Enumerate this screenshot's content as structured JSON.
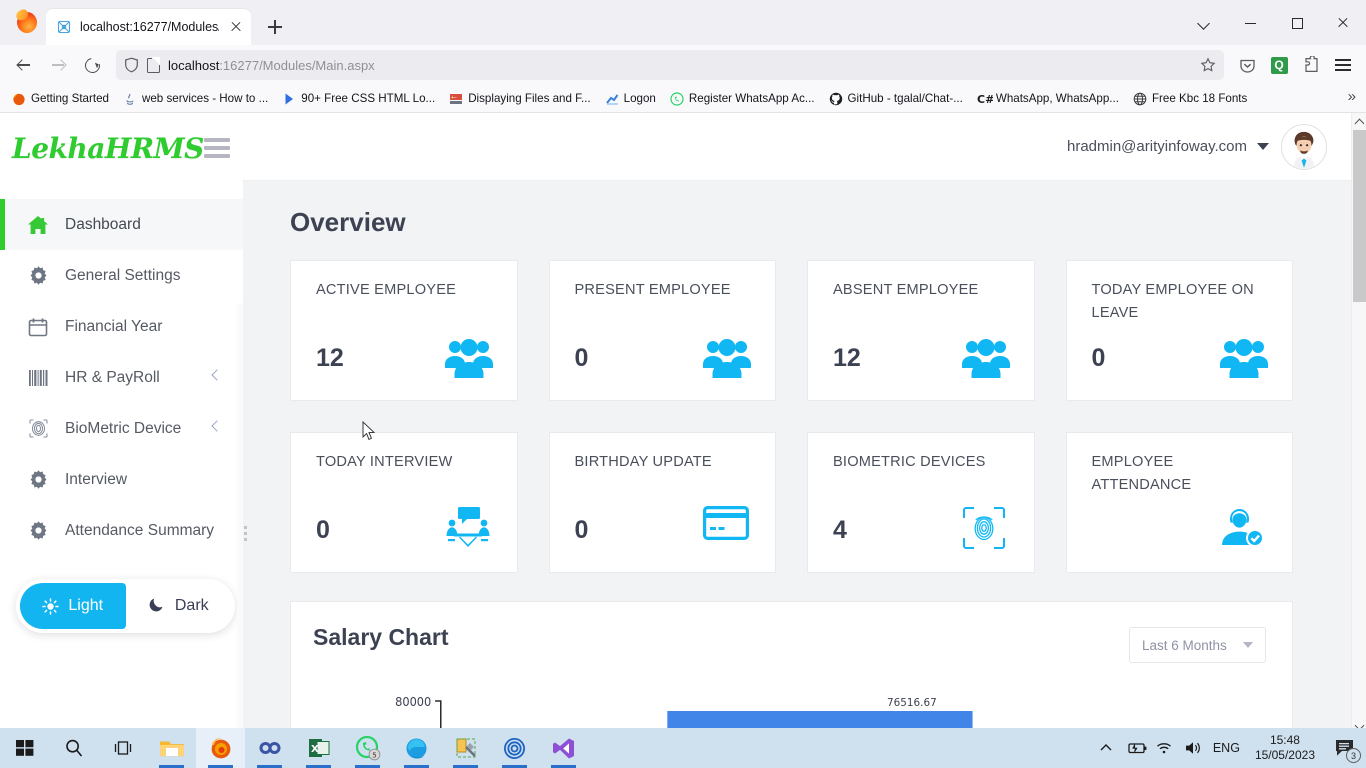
{
  "browser": {
    "tab": {
      "title": "localhost:16277/Modules/Main.",
      "favicon": "site-favicon"
    },
    "new_tab_label": "+",
    "url_prefix": "localhost",
    "url_rest": ":16277/Modules/Main.aspx",
    "toolbar_icons": [
      "pocket-icon",
      "quillbot-icon",
      "extensions-icon",
      "firefox-menu-icon"
    ],
    "window_controls": [
      "minimize",
      "maximize",
      "close"
    ],
    "bookmarks": [
      {
        "label": "Getting Started",
        "icon": "firefox-icon"
      },
      {
        "label": "web services - How to ...",
        "icon": "java-icon"
      },
      {
        "label": "90+ Free CSS HTML Lo...",
        "icon": "play-icon"
      },
      {
        "label": "Displaying Files and F...",
        "icon": "docs-icon"
      },
      {
        "label": "Logon",
        "icon": "chart-icon"
      },
      {
        "label": "Register WhatsApp Ac...",
        "icon": "whatsapp-icon"
      },
      {
        "label": "GitHub - tgalal/Chat-...",
        "icon": "github-icon"
      },
      {
        "label": "WhatsApp, WhatsApp...",
        "icon": "csharp-icon"
      },
      {
        "label": "Free Kbc 18 Fonts",
        "icon": "globe-icon"
      }
    ],
    "bookmarks_overflow": "»"
  },
  "app": {
    "brand": "LekhaHRMS",
    "menu_toggle": "hamburger-icon",
    "sidebar": {
      "items": [
        {
          "label": "Dashboard",
          "icon": "home-icon",
          "active": true,
          "expandable": false
        },
        {
          "label": "General Settings",
          "icon": "gear-icon",
          "active": false,
          "expandable": false
        },
        {
          "label": "Financial Year",
          "icon": "calendar-icon",
          "active": false,
          "expandable": false
        },
        {
          "label": "HR & PayRoll",
          "icon": "barcode-icon",
          "active": false,
          "expandable": true
        },
        {
          "label": "BioMetric Device",
          "icon": "fingerprint-icon",
          "active": false,
          "expandable": true
        },
        {
          "label": "Interview",
          "icon": "gear-icon",
          "active": false,
          "expandable": false
        },
        {
          "label": "Attendance Summary",
          "icon": "gear-icon",
          "active": false,
          "expandable": false
        }
      ],
      "theme": {
        "light_label": "Light",
        "dark_label": "Dark",
        "selected": "Light"
      }
    },
    "header": {
      "user_email": "hradmin@arityinfoway.com",
      "avatar": "user-avatar"
    },
    "page_title": "Overview",
    "cards": [
      {
        "label": "ACTIVE EMPLOYEE",
        "value": "12",
        "icon": "users-group-icon"
      },
      {
        "label": "PRESENT EMPLOYEE",
        "value": "0",
        "icon": "users-group-icon"
      },
      {
        "label": "ABSENT EMPLOYEE",
        "value": "12",
        "icon": "users-group-icon"
      },
      {
        "label": "TODAY EMPLOYEE ON LEAVE",
        "value": "0",
        "icon": "users-group-icon"
      },
      {
        "label": "TODAY INTERVIEW",
        "value": "0",
        "icon": "interview-icon"
      },
      {
        "label": "BIRTHDAY UPDATE",
        "value": "0",
        "icon": "card-icon"
      },
      {
        "label": "BIOMETRIC DEVICES",
        "value": "4",
        "icon": "fingerprint-scan-icon"
      },
      {
        "label": "EMPLOYEE ATTENDANCE",
        "value": "",
        "icon": "employee-check-icon"
      }
    ],
    "chart": {
      "title": "Salary Chart",
      "range_selected": "Last 6 Months",
      "range_options": [
        "Last 6 Months"
      ]
    },
    "colors": {
      "accent_cyan": "#13b5f0",
      "brand_green": "#2ecc2e",
      "bar_blue": "#4285e8",
      "text_dark": "#3d4253"
    }
  },
  "chart_data": {
    "type": "bar",
    "title": "Salary Chart",
    "categories": [
      "",
      ""
    ],
    "values": [
      0,
      76516.67
    ],
    "data_labels": [
      "",
      "76516.67"
    ],
    "ylabel": "",
    "xlabel": "",
    "ytick_labels": [
      "80000"
    ],
    "yticks": [
      80000
    ],
    "ylim": [
      0,
      80000
    ],
    "grid": false,
    "legend": "none",
    "bar_color": "#4285e8"
  },
  "taskbar": {
    "items": [
      {
        "name": "start-button",
        "icon": "windows-icon"
      },
      {
        "name": "search-button",
        "icon": "search-icon"
      },
      {
        "name": "task-view-button",
        "icon": "task-view-icon"
      },
      {
        "name": "file-explorer",
        "icon": "folder-icon"
      },
      {
        "name": "firefox",
        "icon": "firefox-icon"
      },
      {
        "name": "azure-devops",
        "icon": "infinity-icon"
      },
      {
        "name": "excel",
        "icon": "excel-icon"
      },
      {
        "name": "whatsapp",
        "icon": "whatsapp-icon",
        "badge": "5"
      },
      {
        "name": "edge",
        "icon": "edge-icon"
      },
      {
        "name": "sql-tool",
        "icon": "sql-tool-icon"
      },
      {
        "name": "app-target",
        "icon": "target-icon"
      },
      {
        "name": "visual-studio",
        "icon": "visual-studio-icon"
      }
    ],
    "tray": {
      "show_hidden": "chevron-up-icon",
      "battery": "battery-charging-icon",
      "network": "wifi-icon",
      "volume": "volume-icon",
      "language": "ENG",
      "time": "15:48",
      "date": "15/05/2023",
      "notifications_badge": "3"
    }
  }
}
